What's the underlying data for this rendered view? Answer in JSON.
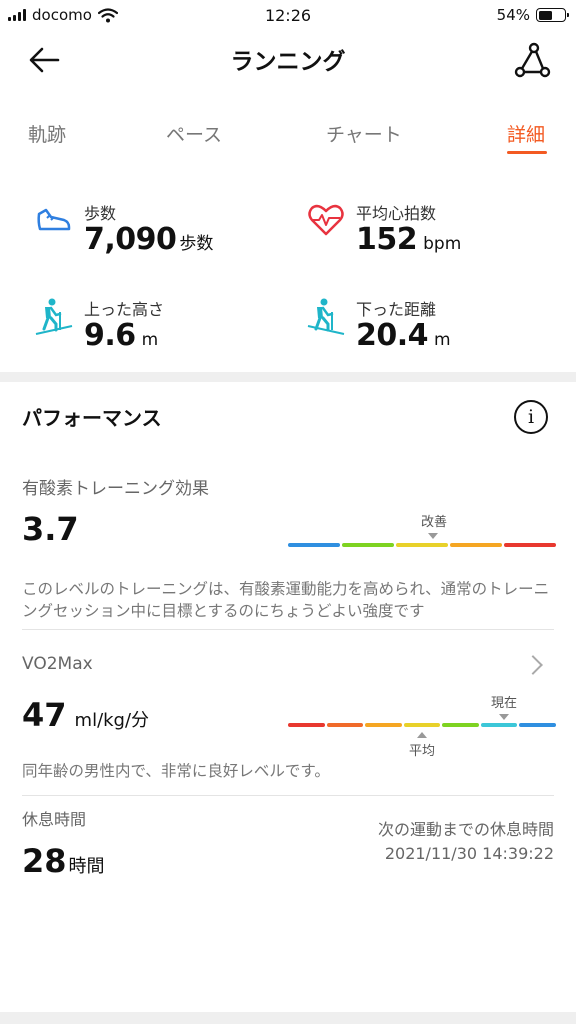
{
  "status_bar": {
    "carrier": "docomo",
    "time": "12:26",
    "battery_text": "54%",
    "battery_level": 0.54
  },
  "header": {
    "title": "ランニング"
  },
  "tabs": [
    {
      "label": "軌跡"
    },
    {
      "label": "ペース"
    },
    {
      "label": "チャート"
    },
    {
      "label": "詳細",
      "active": true
    }
  ],
  "stats": {
    "steps": {
      "label": "歩数",
      "value": "7,090",
      "unit": "歩数"
    },
    "heart_rate": {
      "label": "平均心拍数",
      "value": "152",
      "unit": "bpm"
    },
    "ascent": {
      "label": "上った高さ",
      "value": "9.6",
      "unit": "m"
    },
    "descent": {
      "label": "下った距離",
      "value": "20.4",
      "unit": "m"
    }
  },
  "performance": {
    "title": "パフォーマンス",
    "aerobic": {
      "label": "有酸素トレーニング効果",
      "value": "3.7",
      "marker_label": "改善",
      "description": "このレベルのトレーニングは、有酸素運動能力を高められ、通常のトレーニングセッション中に目標とするのにちょうどよい強度です",
      "scale_colors": [
        "#2f8fe0",
        "#7ed321",
        "#e8d12a",
        "#f5a623",
        "#e8382f"
      ]
    },
    "vo2max": {
      "label": "VO2Max",
      "value": "47",
      "unit": "ml/kg/分",
      "current_label": "現在",
      "average_label": "平均",
      "description": "同年齢の男性内で、非常に良好レベルです。",
      "scale_colors": [
        "#e8382f",
        "#f06a2a",
        "#f5a623",
        "#e8d12a",
        "#7ed321",
        "#3cc7d8",
        "#2f8fe0"
      ]
    },
    "rest": {
      "label": "休息時間",
      "value": "28",
      "unit": "時間",
      "next_label": "次の運動までの休息時間",
      "next_time": "2021/11/30 14:39:22"
    }
  },
  "colors": {
    "accent": "#f35a22",
    "teal_icon": "#1fb5c9",
    "heart": "#e8333f",
    "shoe": "#2f7fe0"
  }
}
